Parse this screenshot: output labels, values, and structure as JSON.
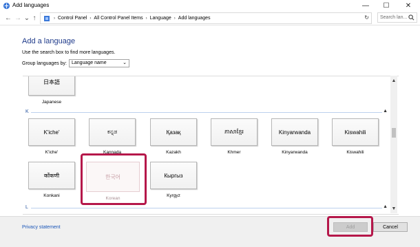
{
  "window": {
    "title": "Add languages",
    "minimize_glyph": "—",
    "maximize_glyph": "☐",
    "close_glyph": "✕"
  },
  "nav": {
    "back_glyph": "←",
    "forward_glyph": "→",
    "recent_glyph": "⌄",
    "up_glyph": "↑",
    "crumb_sep": "›",
    "refresh_glyph": "↻",
    "breadcrumbs": [
      "Control Panel",
      "All Control Panel Items",
      "Language",
      "Add languages"
    ]
  },
  "search": {
    "placeholder": "Search lan..."
  },
  "page": {
    "heading": "Add a language",
    "hint": "Use the search box to find more languages.",
    "group_label": "Group languages by:",
    "group_value": "Language name",
    "chevron_glyph": "⌄"
  },
  "sections": {
    "k": "K",
    "l": "L",
    "caret_up": "▲"
  },
  "tiles": {
    "japanese": {
      "native": "日本語",
      "name": "Japanese"
    },
    "kiche": {
      "native": "K'iche'",
      "name": "K'iche'"
    },
    "kannada": {
      "native": "ಕನ್ನಡ",
      "name": "Kannada"
    },
    "kazakh": {
      "native": "Қазақ",
      "name": "Kazakh"
    },
    "khmer": {
      "native": "ភាសាខ្មែរ",
      "name": "Khmer"
    },
    "kinyarwanda": {
      "native": "Kinyarwanda",
      "name": "Kinyarwanda"
    },
    "kiswahili": {
      "native": "Kiswahili",
      "name": "Kiswahili"
    },
    "konkani": {
      "native": "कोंकणी",
      "name": "Konkani"
    },
    "korean": {
      "native": "한국어",
      "name": "Korean"
    },
    "kyrgyz": {
      "native": "Кыргыз",
      "name": "Kyrgyz"
    }
  },
  "scrollbar": {
    "up": "▲",
    "down": "▼"
  },
  "footer": {
    "privacy": "Privacy statement",
    "add": "Add",
    "cancel": "Cancel"
  },
  "colors": {
    "highlight": "#b5174a",
    "heading": "#1e3a8a",
    "link": "#1a56b8"
  }
}
